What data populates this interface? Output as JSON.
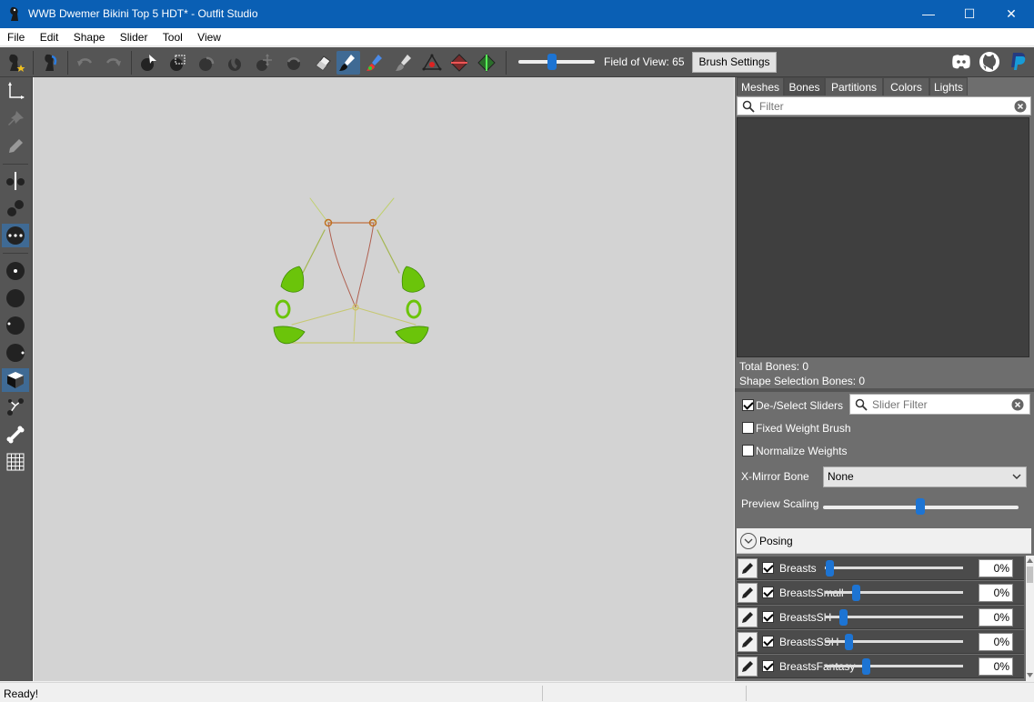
{
  "window": {
    "title": "WWB Dwemer Bikini Top 5 HDT* - Outfit Studio"
  },
  "menu": [
    "File",
    "Edit",
    "Shape",
    "Slider",
    "Tool",
    "View"
  ],
  "toolbar": {
    "fov_label": "Field of View: 65",
    "fov_value": 65,
    "brush_settings_label": "Brush Settings"
  },
  "tabs": [
    "Meshes",
    "Bones",
    "Partitions",
    "Colors",
    "Lights"
  ],
  "bones": {
    "filter_placeholder": "Filter",
    "total_label": "Total Bones: 0",
    "shape_selection_label": "Shape Selection Bones: 0"
  },
  "options": {
    "deselect_sliders_label": "De-/Select Sliders",
    "deselect_sliders_checked": true,
    "slider_filter_placeholder": "Slider Filter",
    "fixed_weight_label": "Fixed Weight Brush",
    "normalize_weights_label": "Normalize Weights",
    "xmirror_label": "X-Mirror Bone",
    "xmirror_value": "None",
    "preview_scaling_label": "Preview Scaling",
    "posing_label": "Posing"
  },
  "sliders": [
    {
      "name": "Breasts",
      "value": "0%",
      "checked": true
    },
    {
      "name": "BreastsSmall",
      "value": "0%",
      "checked": true
    },
    {
      "name": "BreastsSH",
      "value": "0%",
      "checked": true
    },
    {
      "name": "BreastsSSH",
      "value": "0%",
      "checked": true
    },
    {
      "name": "BreastsFantasy",
      "value": "0%",
      "checked": true
    }
  ],
  "status": {
    "text": "Ready!"
  },
  "colors": {
    "titlebar": "#0a5fb4",
    "accent": "#1d74d3",
    "mesh_green": "#6bc40a"
  }
}
